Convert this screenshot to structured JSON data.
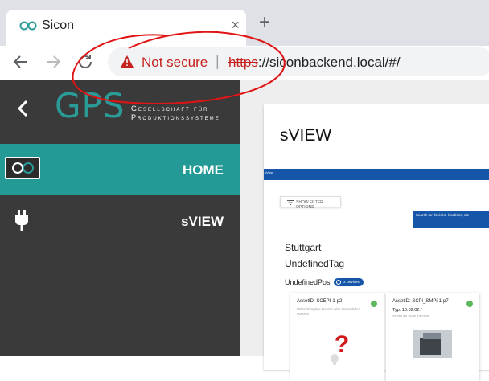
{
  "browser": {
    "tab_title": "Sicon",
    "tab_close": "×",
    "new_tab": "+",
    "security_label": "Not secure",
    "separator": "|",
    "url_scheme": "https",
    "url_rest": "://siconbackend.local/#/"
  },
  "sidebar": {
    "logo_letters": "GPS",
    "logo_line1": "Gesellschaft für",
    "logo_line2": "Produktionssysteme",
    "items": [
      {
        "label": "HOME",
        "icon": "sicon-logo-icon",
        "active": true
      },
      {
        "label": "sVIEW",
        "icon": "plug-icon",
        "active": false
      }
    ],
    "active_color": "#239a96"
  },
  "main": {
    "title": "sVIEW",
    "bar_text": "sView",
    "filter_label": "SHOW FILTER OPTIONS",
    "search_placeholder": "Search for devices, locations, etc",
    "location": "Stuttgart",
    "tag": "UndefinedTag",
    "position": "UndefinedPos",
    "device_count": "3 Devices",
    "assets": [
      {
        "id": "AssetID: SCEPI-1-p2",
        "desc": "IEEU Template Device with SicModules 000002"
      },
      {
        "id": "AssetID: SCPi_SMPi-1-p7",
        "type": "Typ: 10.02.02.*",
        "sub": "SCIPI 88 SMP 100220"
      }
    ]
  },
  "colors": {
    "accent": "#239a96",
    "sidebar_bg": "#3a3a3a",
    "bar_blue": "#1656a8",
    "warning_red": "#c5221f"
  }
}
